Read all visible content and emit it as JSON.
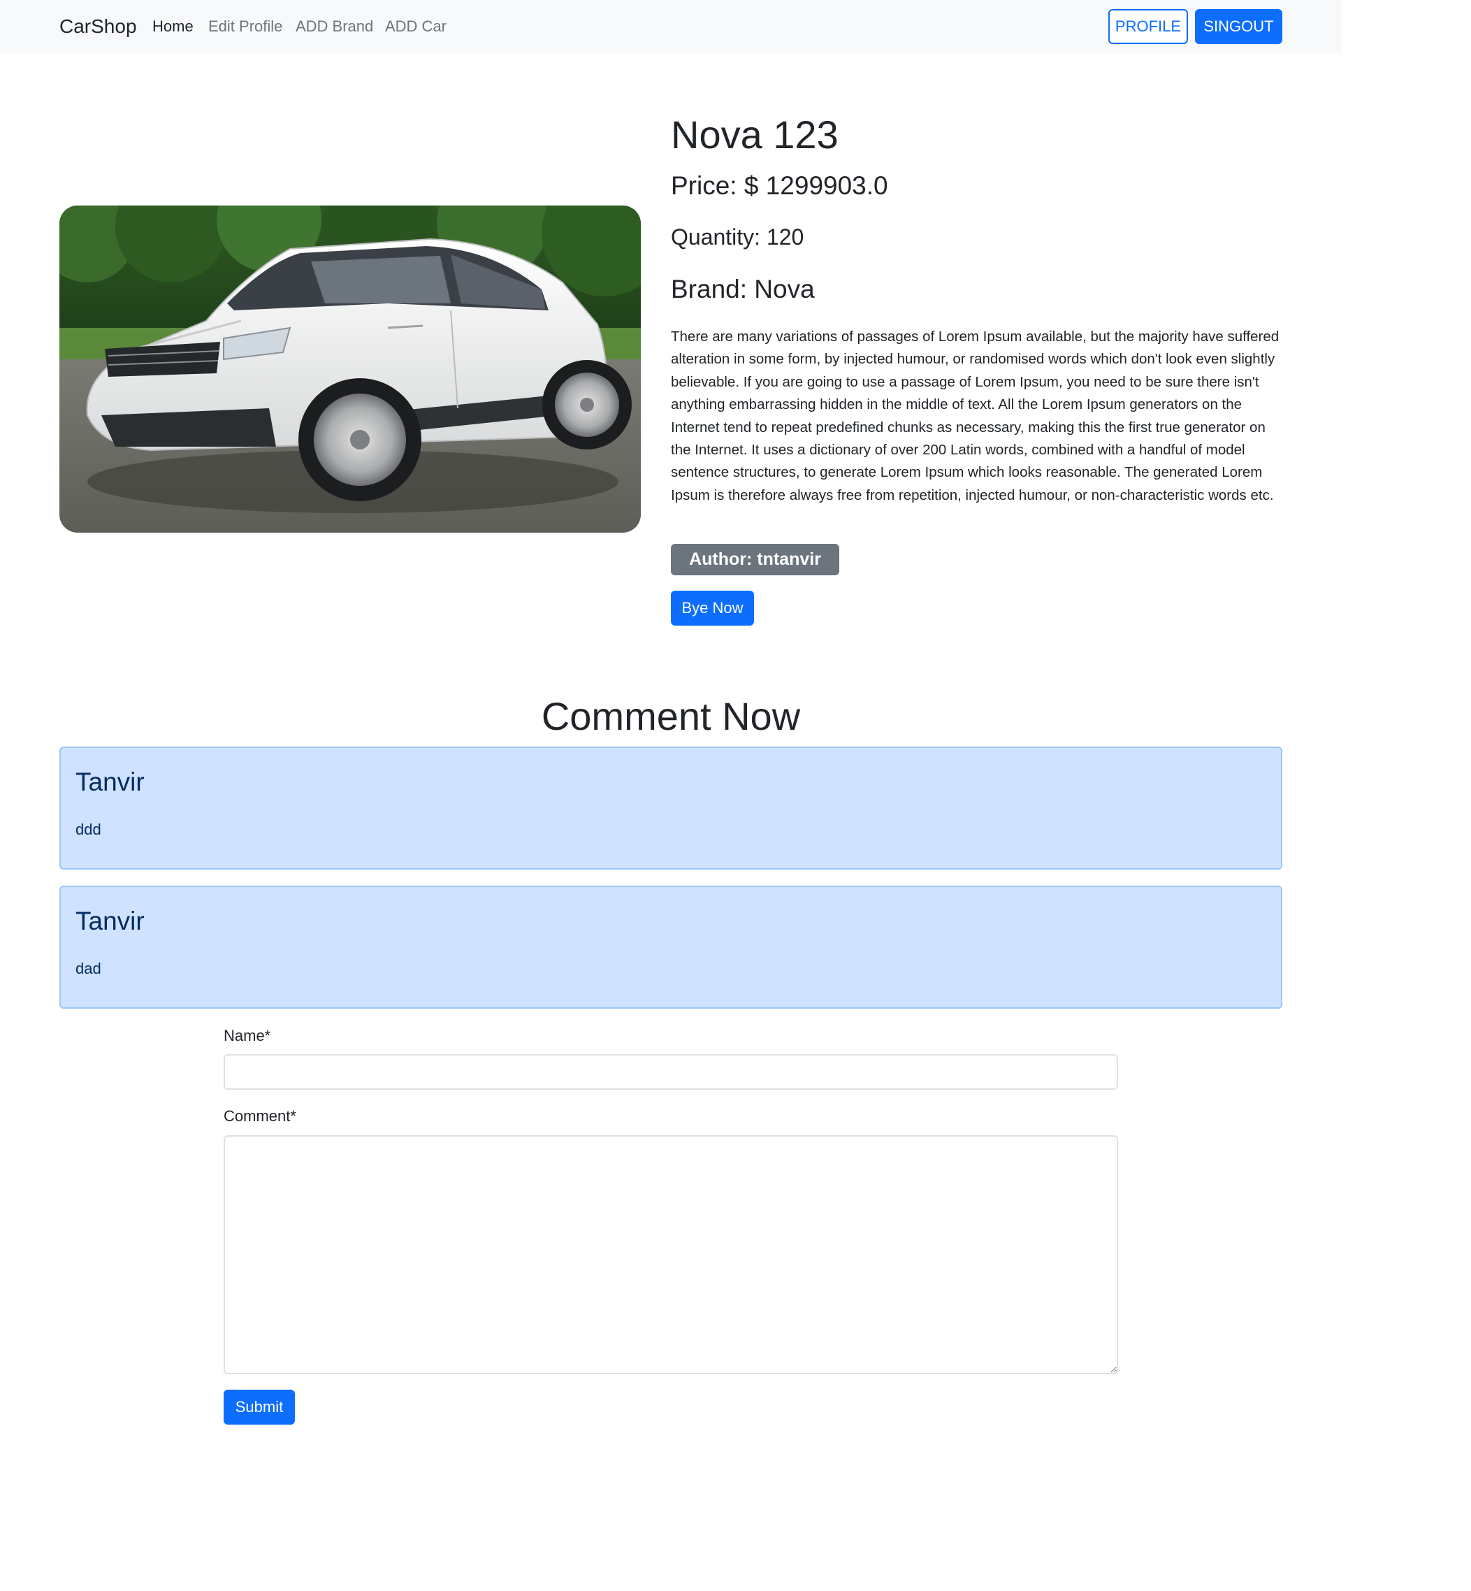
{
  "navbar": {
    "brand": "CarShop",
    "links": [
      {
        "label": "Home",
        "active": true
      },
      {
        "label": "Edit Profile",
        "active": false
      },
      {
        "label": "ADD Brand",
        "active": false
      },
      {
        "label": "ADD Car",
        "active": false
      }
    ],
    "profile_button": "PROFILE",
    "signout_button": "SINGOUT"
  },
  "product": {
    "title": "Nova 123",
    "price": "Price: $ 1299903.0",
    "quantity": "Quantity: 120",
    "brand": "Brand: Nova",
    "description": "There are many variations of passages of Lorem Ipsum available, but the majority have suffered alteration in some form, by injected humour, or randomised words which don't look even slightly believable. If you are going to use a passage of Lorem Ipsum, you need to be sure there isn't anything embarrassing hidden in the middle of text. All the Lorem Ipsum generators on the Internet tend to repeat predefined chunks as necessary, making this the first true generator on the Internet. It uses a dictionary of over 200 Latin words, combined with a handful of model sentence structures, to generate Lorem Ipsum which looks reasonable. The generated Lorem Ipsum is therefore always free from repetition, injected humour, or non-characteristic words etc.",
    "author_badge": "Author: tntanvir",
    "buy_button": "Bye Now"
  },
  "comments": {
    "heading": "Comment Now",
    "items": [
      {
        "name": "Tanvir",
        "text": "ddd"
      },
      {
        "name": "Tanvir",
        "text": "dad"
      }
    ]
  },
  "form": {
    "name_label": "Name*",
    "name_value": "",
    "comment_label": "Comment*",
    "comment_value": "",
    "submit_button": "Submit"
  },
  "colors": {
    "primary": "#0d6efd",
    "navbar_bg": "#f8f9fa",
    "badge_bg": "#6c757d",
    "comment_bg": "#cfe2ff",
    "comment_border": "#9ec5fe",
    "comment_text": "#052c65"
  }
}
